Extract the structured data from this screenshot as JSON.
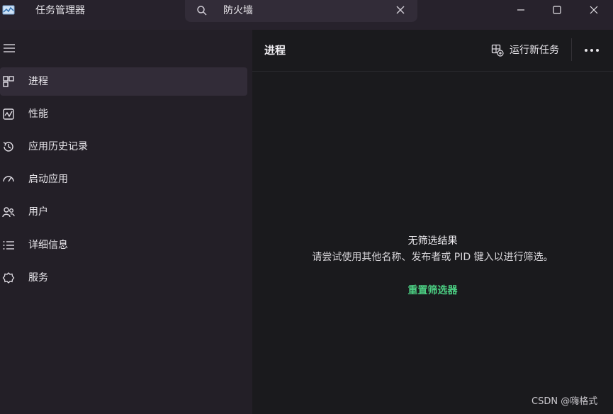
{
  "titlebar": {
    "app_title": "任务管理器",
    "app_icon": "task-manager-icon",
    "search": {
      "value": "防火墙",
      "icon": "search-icon",
      "clear_icon": "close-icon"
    },
    "window_controls": [
      "minimize-icon",
      "maximize-icon",
      "close-icon"
    ]
  },
  "sidebar": {
    "menu_icon": "hamburger-icon",
    "items": [
      {
        "label": "进程",
        "icon": "processes-icon",
        "active": true
      },
      {
        "label": "性能",
        "icon": "performance-icon",
        "active": false
      },
      {
        "label": "应用历史记录",
        "icon": "history-icon",
        "active": false
      },
      {
        "label": "启动应用",
        "icon": "startup-icon",
        "active": false
      },
      {
        "label": "用户",
        "icon": "users-icon",
        "active": false
      },
      {
        "label": "详细信息",
        "icon": "details-icon",
        "active": false
      },
      {
        "label": "服务",
        "icon": "services-icon",
        "active": false
      }
    ]
  },
  "main": {
    "title": "进程",
    "run_task_label": "运行新任务",
    "more_icon": "more-icon",
    "empty_title": "无筛选结果",
    "empty_description": "请尝试使用其他名称、发布者或 PID 键入以进行筛选。",
    "reset_label": "重置筛选器"
  },
  "colors": {
    "accent": "#4ccf83",
    "sidebar_bg": "#231f27",
    "main_bg": "#1a1a1d",
    "active_item_bg": "#322c38"
  },
  "watermark": "CSDN @嗨格式"
}
